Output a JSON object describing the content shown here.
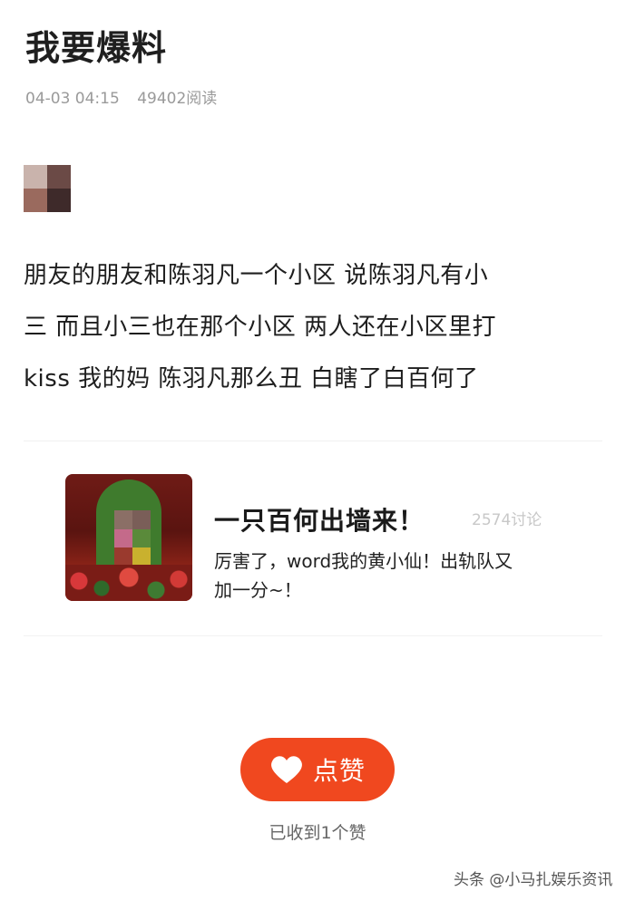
{
  "post": {
    "title": "我要爆料",
    "date": "04-03 04:15",
    "reads": "49402阅读",
    "body_lines": [
      "朋友的朋友和陈羽凡一个小区 说陈羽凡有小",
      "三 而且小三也在那个小区 两人还在小区里打",
      "kiss 我的妈 陈羽凡那么丑 白瞎了白百何了"
    ]
  },
  "card": {
    "title": "一只百何出墙来！",
    "discussion_count": "2574讨论",
    "desc_lines": [
      "厉害了，word我的黄小仙！出轨队又",
      "加一分~！"
    ]
  },
  "like": {
    "label": "点赞",
    "received": "已收到1个赞"
  },
  "watermark": "头条 @小马扎娱乐资讯",
  "colors": {
    "accent": "#f0481f",
    "meta_text": "#9a9a9a"
  },
  "icons": {
    "like": "heart-icon"
  }
}
